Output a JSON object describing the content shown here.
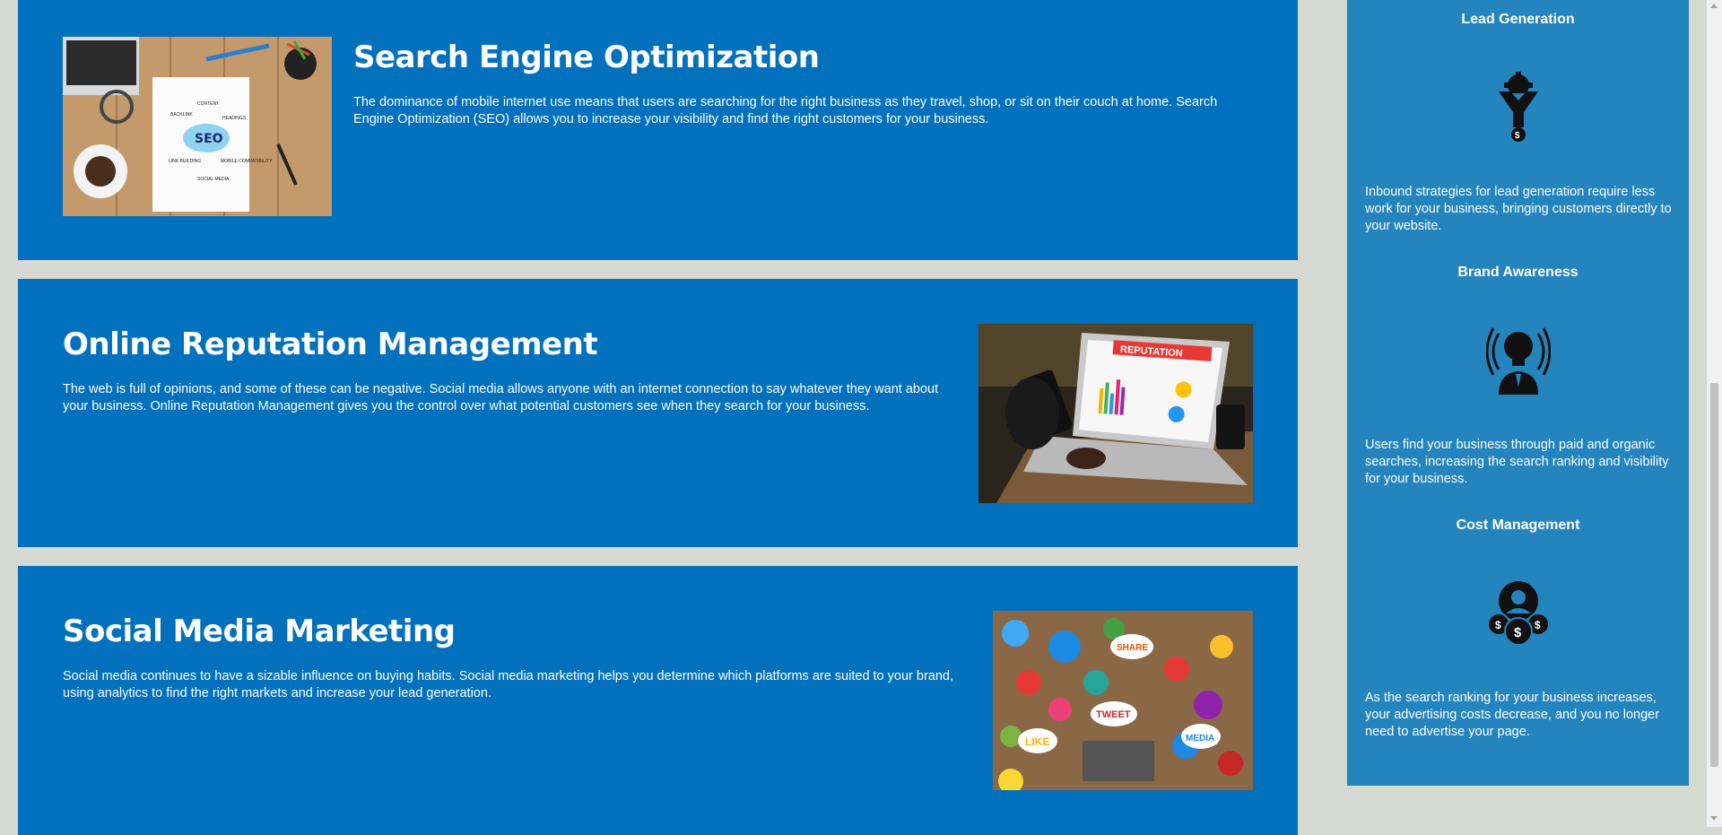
{
  "services": [
    {
      "title": "Search Engine Optimization",
      "text": "The dominance of mobile internet use means that users are searching for the right business as they travel, shop, or sit on their couch at home. Search Engine Optimization (SEO) allows you to increase your visibility and find the right customers for your business.",
      "image_words": [
        "SEO",
        "CONTENT",
        "HEADINGS",
        "BACKLINK",
        "LINK BUILDING",
        "MOBILE COMPATIBILITY",
        "SOCIAL MEDIA"
      ]
    },
    {
      "title": "Online Reputation Management",
      "text": "The web is full of opinions, and some of these can be negative. Social media allows anyone with an internet connection to say whatever they want about your business. Online Reputation Management gives you the control over what potential customers see when they search for your business.",
      "image_words": [
        "REPUTATION"
      ]
    },
    {
      "title": "Social Media Marketing",
      "text": "Social media continues to have a sizable influence on buying habits. Social media marketing helps you determine which platforms are suited to your brand, using analytics to find the right markets and increase your lead generation.",
      "image_words": [
        "SHARE",
        "TWEET",
        "LIKE",
        "MEDIA"
      ]
    }
  ],
  "sidebar": {
    "features": [
      {
        "title": "Lead Generation",
        "icon": "funnel-gear-icon",
        "text": "Inbound strategies for lead generation require less work for your business, bringing customers directly to your website."
      },
      {
        "title": "Brand Awareness",
        "icon": "lightbulb-broadcast-icon",
        "text": "Users find your business through paid and organic searches, increasing the search ranking and visibility for your business."
      },
      {
        "title": "Cost Management",
        "icon": "gear-coins-icon",
        "text": "As the search ranking for your business increases, your advertising costs decrease, and you no longer need to advertise your page."
      }
    ]
  },
  "colors": {
    "card_bg": "#0171bd",
    "sidebar_bg": "#2484be",
    "page_bg": "#d6d8d2"
  }
}
